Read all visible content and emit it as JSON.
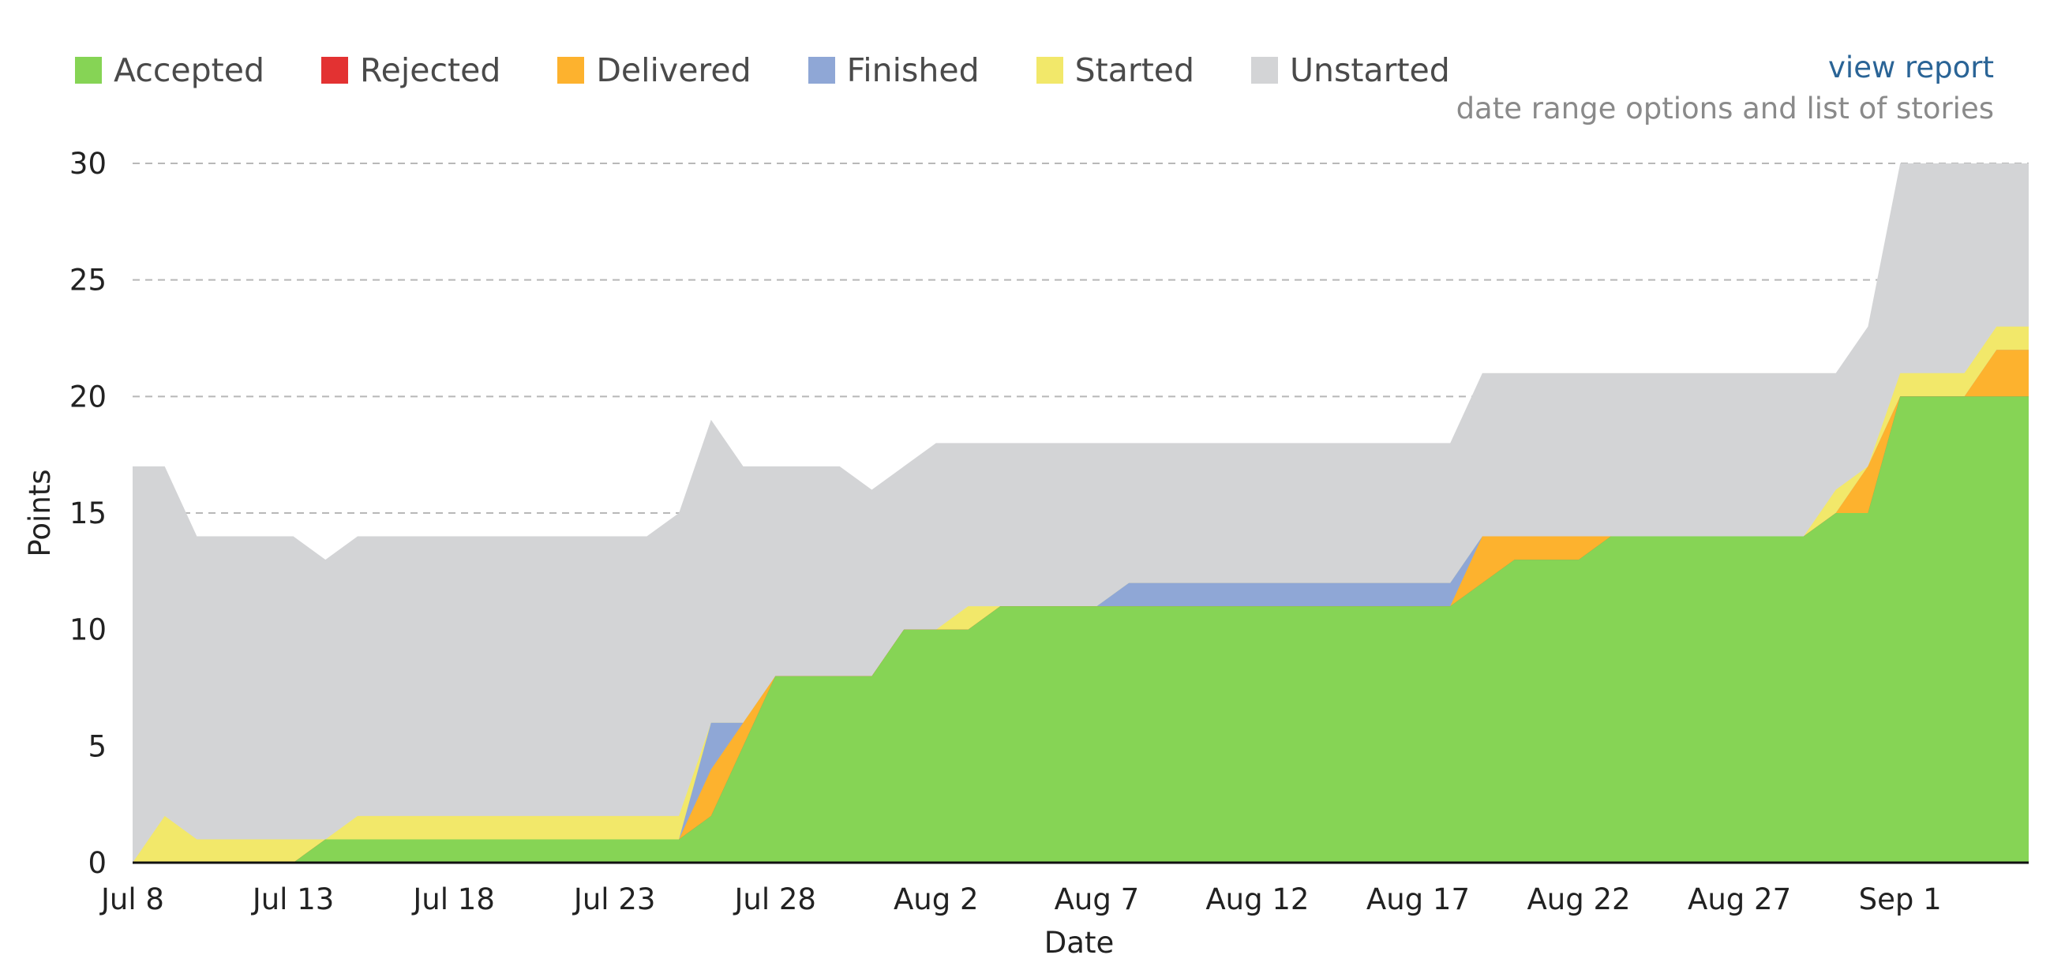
{
  "header": {
    "view_report": "view report",
    "subtitle": "date range options and list of stories"
  },
  "legend": [
    {
      "name": "Accepted",
      "color": "#86d455"
    },
    {
      "name": "Rejected",
      "color": "#e33232"
    },
    {
      "name": "Delivered",
      "color": "#fdb22e"
    },
    {
      "name": "Finished",
      "color": "#8fa7d6"
    },
    {
      "name": "Started",
      "color": "#f2e86a"
    },
    {
      "name": "Unstarted",
      "color": "#d3d4d6"
    }
  ],
  "chart_data": {
    "type": "area",
    "stacked": true,
    "title": "",
    "xlabel": "Date",
    "ylabel": "Points",
    "ylim": [
      0,
      30
    ],
    "yticks": [
      0,
      5,
      10,
      15,
      20,
      25,
      30
    ],
    "xticks": [
      "Jul 8",
      "Jul 13",
      "Jul 18",
      "Jul 23",
      "Jul 28",
      "Aug 2",
      "Aug 7",
      "Aug 12",
      "Aug 17",
      "Aug 22",
      "Aug 27",
      "Sep 1"
    ],
    "x": [
      "Jul 8",
      "Jul 9",
      "Jul 10",
      "Jul 11",
      "Jul 12",
      "Jul 13",
      "Jul 14",
      "Jul 15",
      "Jul 16",
      "Jul 17",
      "Jul 18",
      "Jul 19",
      "Jul 20",
      "Jul 21",
      "Jul 22",
      "Jul 23",
      "Jul 24",
      "Jul 25",
      "Jul 26",
      "Jul 27",
      "Jul 28",
      "Jul 29",
      "Jul 30",
      "Jul 31",
      "Aug 1",
      "Aug 2",
      "Aug 3",
      "Aug 4",
      "Aug 5",
      "Aug 6",
      "Aug 7",
      "Aug 8",
      "Aug 9",
      "Aug 10",
      "Aug 11",
      "Aug 12",
      "Aug 13",
      "Aug 14",
      "Aug 15",
      "Aug 16",
      "Aug 17",
      "Aug 18",
      "Aug 19",
      "Aug 20",
      "Aug 21",
      "Aug 22",
      "Aug 23",
      "Aug 24",
      "Aug 25",
      "Aug 26",
      "Aug 27",
      "Aug 28",
      "Aug 29",
      "Aug 30",
      "Aug 31",
      "Sep 1",
      "Sep 2",
      "Sep 3",
      "Sep 4",
      "Sep 5"
    ],
    "series": [
      {
        "name": "Accepted",
        "color": "#86d455",
        "values": [
          0,
          0,
          0,
          0,
          0,
          0,
          1,
          1,
          1,
          1,
          1,
          1,
          1,
          1,
          1,
          1,
          1,
          1,
          2,
          5,
          8,
          8,
          8,
          8,
          10,
          10,
          10,
          11,
          11,
          11,
          11,
          11,
          11,
          11,
          11,
          11,
          11,
          11,
          11,
          11,
          11,
          11,
          12,
          13,
          13,
          13,
          14,
          14,
          14,
          14,
          14,
          14,
          14,
          15,
          15,
          20,
          20,
          20,
          20,
          20
        ]
      },
      {
        "name": "Rejected",
        "color": "#e33232",
        "values": [
          0,
          0,
          0,
          0,
          0,
          0,
          0,
          0,
          0,
          0,
          0,
          0,
          0,
          0,
          0,
          0,
          0,
          0,
          0,
          0,
          0,
          0,
          0,
          0,
          0,
          0,
          0,
          0,
          0,
          0,
          0,
          0,
          0,
          0,
          0,
          0,
          0,
          0,
          0,
          0,
          0,
          0,
          0,
          0,
          0,
          0,
          0,
          0,
          0,
          0,
          0,
          0,
          0,
          0,
          0,
          0,
          0,
          0,
          0,
          0
        ]
      },
      {
        "name": "Delivered",
        "color": "#fdb22e",
        "values": [
          0,
          0,
          0,
          0,
          0,
          0,
          0,
          0,
          0,
          0,
          0,
          0,
          0,
          0,
          0,
          0,
          0,
          0,
          2,
          1,
          0,
          0,
          0,
          0,
          0,
          0,
          0,
          0,
          0,
          0,
          0,
          0,
          0,
          0,
          0,
          0,
          0,
          0,
          0,
          0,
          0,
          0,
          2,
          1,
          1,
          1,
          0,
          0,
          0,
          0,
          0,
          0,
          0,
          0,
          2,
          0,
          0,
          0,
          2,
          2
        ]
      },
      {
        "name": "Finished",
        "color": "#8fa7d6",
        "values": [
          0,
          0,
          0,
          0,
          0,
          0,
          0,
          0,
          0,
          0,
          0,
          0,
          0,
          0,
          0,
          0,
          0,
          0,
          2,
          0,
          0,
          0,
          0,
          0,
          0,
          0,
          0,
          0,
          0,
          0,
          0,
          1,
          1,
          1,
          1,
          1,
          1,
          1,
          1,
          1,
          1,
          1,
          0,
          0,
          0,
          0,
          0,
          0,
          0,
          0,
          0,
          0,
          0,
          0,
          0,
          0,
          0,
          0,
          0,
          0
        ]
      },
      {
        "name": "Started",
        "color": "#f2e86a",
        "values": [
          0,
          2,
          1,
          1,
          1,
          1,
          0,
          1,
          1,
          1,
          1,
          1,
          1,
          1,
          1,
          1,
          1,
          1,
          0,
          0,
          0,
          0,
          0,
          0,
          0,
          0,
          1,
          0,
          0,
          0,
          0,
          0,
          0,
          0,
          0,
          0,
          0,
          0,
          0,
          0,
          0,
          0,
          0,
          0,
          0,
          0,
          0,
          0,
          0,
          0,
          0,
          0,
          0,
          1,
          0,
          1,
          1,
          1,
          1,
          1
        ]
      },
      {
        "name": "Unstarted",
        "color": "#d3d4d6",
        "values": [
          17,
          15,
          13,
          13,
          13,
          13,
          12,
          12,
          12,
          12,
          12,
          12,
          12,
          12,
          12,
          12,
          12,
          13,
          13,
          11,
          9,
          9,
          9,
          8,
          7,
          8,
          7,
          7,
          7,
          7,
          7,
          6,
          6,
          6,
          6,
          6,
          6,
          6,
          6,
          6,
          6,
          6,
          7,
          7,
          7,
          7,
          7,
          7,
          7,
          7,
          7,
          7,
          7,
          5,
          6,
          19,
          19,
          19,
          12,
          12
        ]
      }
    ]
  }
}
